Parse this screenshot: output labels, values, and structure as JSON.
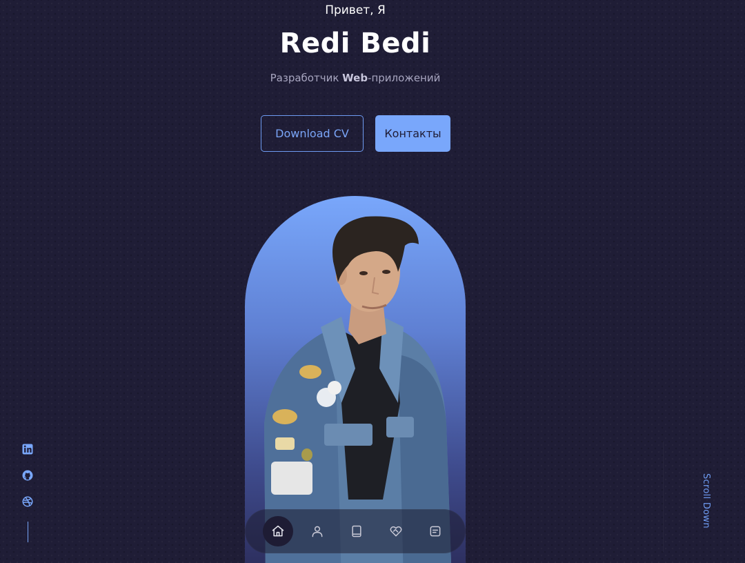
{
  "hero": {
    "greeting": "Привет, Я",
    "name": "Redi Bedi",
    "role_prefix": "Разработчик ",
    "role_bold": "Web",
    "role_suffix": "-приложений"
  },
  "buttons": {
    "download_label": "Download CV",
    "contacts_label": "Контакты"
  },
  "nav": {
    "items": [
      {
        "icon": "home-icon",
        "active": true
      },
      {
        "icon": "user-icon",
        "active": false
      },
      {
        "icon": "book-icon",
        "active": false
      },
      {
        "icon": "heart-handshake-icon",
        "active": false
      },
      {
        "icon": "message-icon",
        "active": false
      }
    ]
  },
  "socials": [
    {
      "icon": "linkedin-icon"
    },
    {
      "icon": "github-icon"
    },
    {
      "icon": "dribbble-icon"
    }
  ],
  "scroll_down_label": "Scroll Down",
  "colors": {
    "background": "#1f1d36",
    "accent": "#79a7fb"
  }
}
